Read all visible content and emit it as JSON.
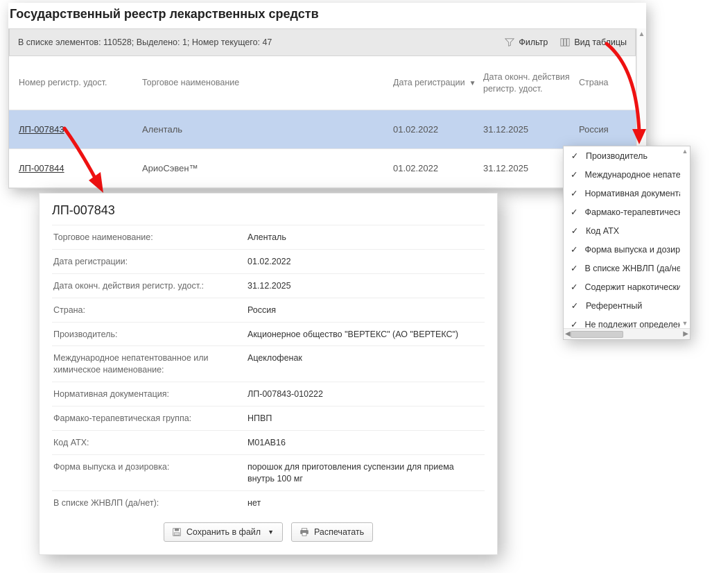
{
  "title": "Государственный реестр лекарственных средств",
  "toolbar": {
    "status": "В списке элементов: 110528; Выделено: 1; Номер текущего: 47",
    "filter_label": "Фильтр",
    "columns_label": "Вид таблицы"
  },
  "columns": {
    "reg_no": "Номер регистр. удост.",
    "trade_name": "Торговое наименование",
    "reg_date": "Дата регистрации",
    "exp_date": "Дата оконч. действия регистр. удост.",
    "country": "Страна"
  },
  "rows": [
    {
      "reg_no": "ЛП-007843",
      "trade_name": "Аленталь",
      "reg_date": "01.02.2022",
      "exp_date": "31.12.2025",
      "country": "Россия",
      "selected": true
    },
    {
      "reg_no": "ЛП-007844",
      "trade_name": "АриоСэвен™",
      "reg_date": "01.02.2022",
      "exp_date": "31.12.2025",
      "country": "",
      "selected": false
    }
  ],
  "detail": {
    "title": "ЛП-007843",
    "fields": [
      {
        "label": "Торговое наименование:",
        "value": "Аленталь"
      },
      {
        "label": "Дата регистрации:",
        "value": "01.02.2022"
      },
      {
        "label": "Дата оконч. действия регистр. удост.:",
        "value": "31.12.2025"
      },
      {
        "label": "Страна:",
        "value": "Россия"
      },
      {
        "label": "Производитель:",
        "value": "Акционерное общество \"ВЕРТЕКС\" (АО \"ВЕРТЕКС\")"
      },
      {
        "label": "Международное непатентованное или химическое наименование:",
        "value": "Ацеклофенак"
      },
      {
        "label": "Нормативная документация:",
        "value": "ЛП-007843-010222"
      },
      {
        "label": "Фармако-терапевтическая группа:",
        "value": "НПВП"
      },
      {
        "label": "Код АТХ:",
        "value": "M01AB16"
      },
      {
        "label": "Форма выпуска и дозировка:",
        "value": "порошок для приготовления суспензии для приема внутрь 100 мг"
      },
      {
        "label": "В списке ЖНВЛП (да/нет):",
        "value": "нет"
      }
    ],
    "save_label": "Сохранить в файл",
    "print_label": "Распечатать"
  },
  "column_menu": {
    "items": [
      "Производитель",
      "Международное непатенто",
      "Нормативная документаци",
      "Фармако-терапевтическая",
      "Код АТХ",
      "Форма выпуска и дозировк",
      "В списке ЖНВЛП (да/нет)",
      "Содержит наркотическите",
      "Референтный",
      "Не подлежит определению"
    ]
  }
}
